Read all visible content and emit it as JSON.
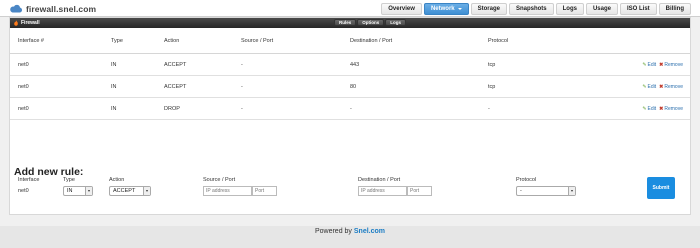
{
  "app": {
    "brand": "firewall.snel.com"
  },
  "nav": {
    "tabs": [
      {
        "label": "Overview"
      },
      {
        "label": "Network",
        "active": true
      },
      {
        "label": "Storage"
      },
      {
        "label": "Snapshots"
      },
      {
        "label": "Logs"
      },
      {
        "label": "Usage"
      },
      {
        "label": "ISO List"
      },
      {
        "label": "Billing"
      }
    ]
  },
  "panel": {
    "title": "Firewall",
    "subtabs": [
      "Rules",
      "Options",
      "Logs"
    ]
  },
  "table": {
    "headers": {
      "interface": "Interface #",
      "type": "Type",
      "action": "Action",
      "source": "Source / Port",
      "destination": "Destination / Port",
      "protocol": "Protocol"
    },
    "edit_label": "Edit",
    "remove_label": "Remove",
    "rows": [
      {
        "interface": "net0",
        "type": "IN",
        "action": "ACCEPT",
        "source": "-",
        "destination": "443",
        "protocol": "tcp"
      },
      {
        "interface": "net0",
        "type": "IN",
        "action": "ACCEPT",
        "source": "-",
        "destination": "80",
        "protocol": "tcp"
      },
      {
        "interface": "net0",
        "type": "IN",
        "action": "DROP",
        "source": "-",
        "destination": "-",
        "protocol": "-"
      }
    ]
  },
  "add_rule": {
    "title": "Add new rule:",
    "labels": {
      "interface": "Interface",
      "type": "Type",
      "action": "Action",
      "source": "Source / Port",
      "destination": "Destination / Port",
      "protocol": "Protocol"
    },
    "interface_value": "net0",
    "type_value": "IN",
    "action_value": "ACCEPT",
    "source_ip_placeholder": "IP address",
    "source_port_placeholder": "Port",
    "dest_ip_placeholder": "IP address",
    "dest_port_placeholder": "Port",
    "protocol_value": "-",
    "submit_label": "Submit"
  },
  "footer": {
    "prefix": "Powered by ",
    "link": "Snel.com"
  },
  "colors": {
    "accent": "#1a8de0",
    "active_tab": "#4a98d8",
    "header_dark": "#2e2e2e"
  }
}
